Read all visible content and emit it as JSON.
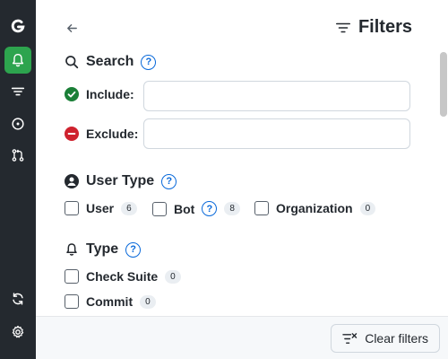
{
  "sidebar": {
    "items": [
      {
        "icon": "gitify-logo-icon"
      },
      {
        "icon": "bell-icon",
        "active": true
      },
      {
        "icon": "filter-icon"
      },
      {
        "icon": "my-issues-icon"
      },
      {
        "icon": "pull-request-icon"
      },
      {
        "icon": "refresh-icon"
      },
      {
        "icon": "gear-icon"
      }
    ],
    "accent": "#2da44e",
    "background": "#24292f"
  },
  "header": {
    "title": "Filters",
    "back_icon": "arrow-left-icon",
    "title_icon": "filter-icon"
  },
  "search": {
    "title": "Search",
    "help": "?",
    "include_label": "Include:",
    "include_value": "",
    "exclude_label": "Exclude:",
    "exclude_value": ""
  },
  "user_type": {
    "title": "User Type",
    "help": "?",
    "options": [
      {
        "label": "User",
        "count": "6",
        "checked": false
      },
      {
        "label": "Bot",
        "count": "8",
        "checked": false,
        "help": "?"
      },
      {
        "label": "Organization",
        "count": "0",
        "checked": false
      }
    ]
  },
  "type": {
    "title": "Type",
    "help": "?",
    "options": [
      {
        "label": "Check Suite",
        "count": "0",
        "checked": false
      },
      {
        "label": "Commit",
        "count": "0",
        "checked": false
      }
    ]
  },
  "footer": {
    "clear_label": "Clear filters",
    "clear_icon": "clear-filter-icon"
  },
  "colors": {
    "include": "#1a7f37",
    "exclude": "#cf222e",
    "help": "#0969da"
  }
}
